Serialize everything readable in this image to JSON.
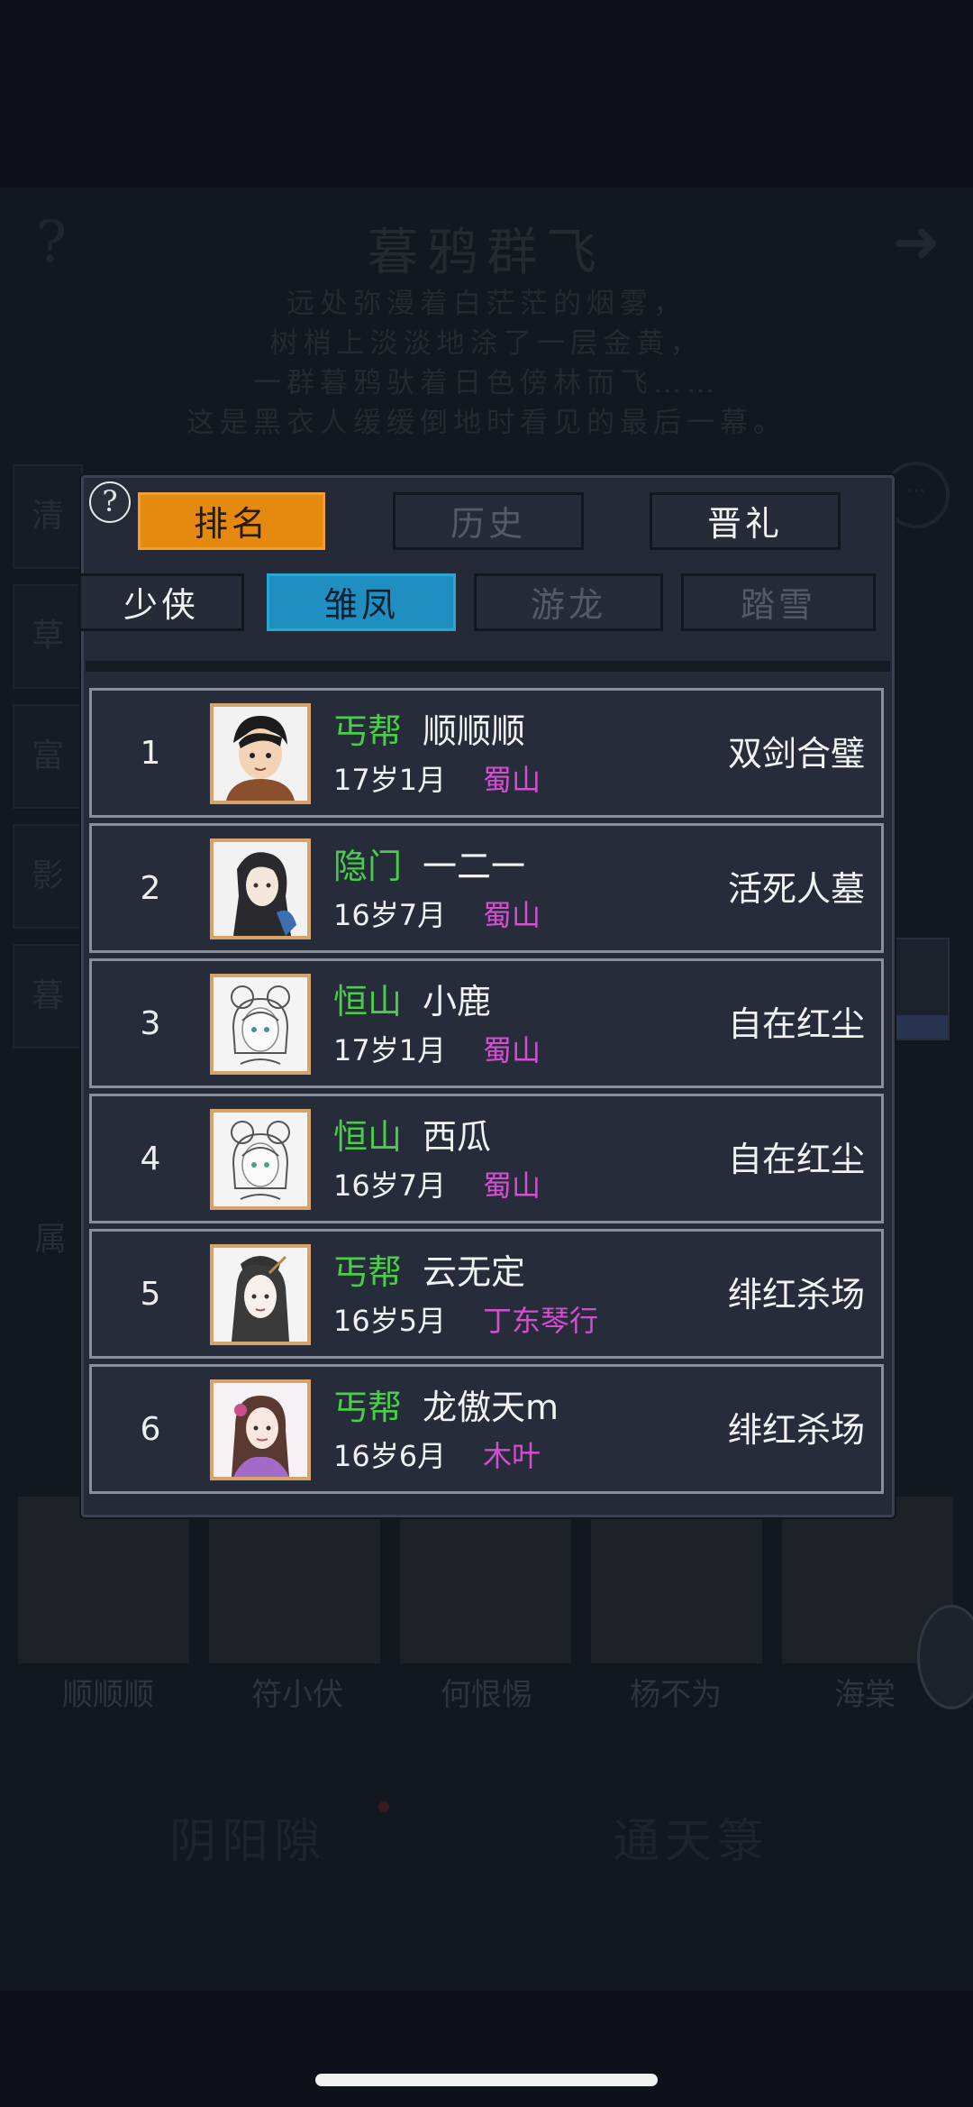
{
  "background": {
    "event_title": "暮鸦群飞",
    "help_glyph": "?",
    "next_glyph": "➜",
    "description": [
      "远处弥漫着白茫茫的烟雾，",
      "树梢上淡淡地涂了一层金黄，",
      "一群暮鸦驮着日色傍林而飞……",
      "这是黑衣人缓缓倒地时看见的最后一幕。"
    ],
    "side_tabs": [
      "清",
      "草",
      "富",
      "影",
      "暮"
    ],
    "side_label": "属",
    "portrait_names": [
      "顺顺顺",
      "符小伏",
      "何恨惕",
      "杨不为",
      "海棠"
    ],
    "bottom_buttons": [
      "阴阳隙",
      "通天箓"
    ]
  },
  "dialog": {
    "help_glyph": "?",
    "main_tabs": [
      {
        "label": "排名",
        "state": "active"
      },
      {
        "label": "历史",
        "state": "inactive"
      },
      {
        "label": "晋礼",
        "state": "inactive-bright"
      }
    ],
    "sub_tabs": [
      {
        "label": "少侠",
        "state": "inactive-bright"
      },
      {
        "label": "雏凤",
        "state": "active"
      },
      {
        "label": "游龙",
        "state": "inactive"
      },
      {
        "label": "踏雪",
        "state": "inactive"
      }
    ],
    "rankings": [
      {
        "rank": "1",
        "sect": "丐帮",
        "name": "顺顺顺",
        "age": "17岁1月",
        "server": "蜀山",
        "title": "双剑合璧",
        "avatar": "young-man-avatar"
      },
      {
        "rank": "2",
        "sect": "隐门",
        "name": "一二一",
        "age": "16岁7月",
        "server": "蜀山",
        "title": "活死人墓",
        "avatar": "long-hair-woman-avatar"
      },
      {
        "rank": "3",
        "sect": "恒山",
        "name": "小鹿",
        "age": "17岁1月",
        "server": "蜀山",
        "title": "自在红尘",
        "avatar": "hair-bun-girl-avatar"
      },
      {
        "rank": "4",
        "sect": "恒山",
        "name": "西瓜",
        "age": "16岁7月",
        "server": "蜀山",
        "title": "自在红尘",
        "avatar": "hair-bun-girl-avatar"
      },
      {
        "rank": "5",
        "sect": "丐帮",
        "name": "云无定",
        "age": "16岁5月",
        "server": "丁东琴行",
        "title": "绯红杀场",
        "avatar": "swordswoman-avatar"
      },
      {
        "rank": "6",
        "sect": "丐帮",
        "name": "龙傲天m",
        "age": "16岁6月",
        "server": "木叶",
        "title": "绯红杀场",
        "avatar": "lady-flower-avatar"
      }
    ]
  },
  "colors": {
    "sect_green": "#4ccc4c",
    "server_magenta": "#d34fd0",
    "tab_orange": "#e68a0f",
    "tab_blue": "#1f8fc2",
    "avatar_border": "#d7a36a"
  }
}
